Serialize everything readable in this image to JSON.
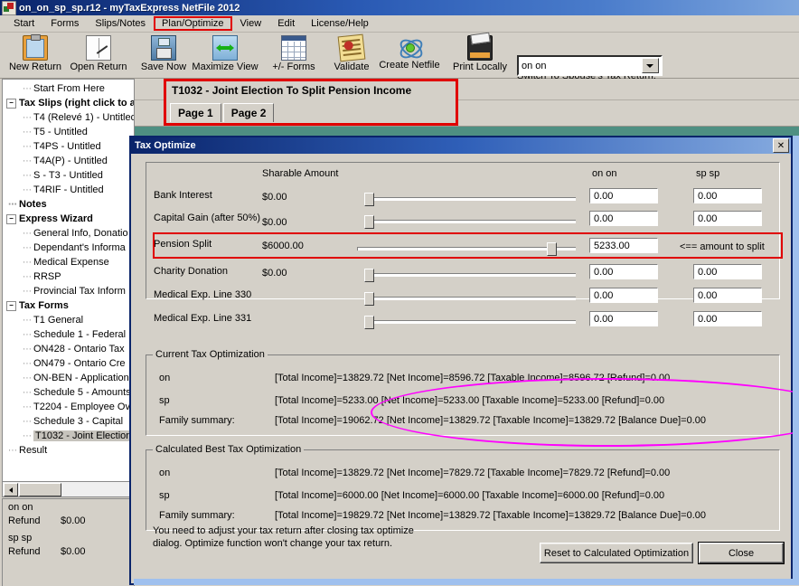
{
  "window": {
    "title": "on_on_sp_sp.r12 - myTaxExpress NetFile 2012",
    "app_icon": "app-icon"
  },
  "menu": {
    "items": [
      {
        "label": "Start",
        "highlighted": false
      },
      {
        "label": "Forms",
        "highlighted": false
      },
      {
        "label": "Slips/Notes",
        "highlighted": false
      },
      {
        "label": "Plan/Optimize",
        "highlighted": true
      },
      {
        "label": "View",
        "highlighted": false
      },
      {
        "label": "Edit",
        "highlighted": false
      },
      {
        "label": "License/Help",
        "highlighted": false
      }
    ]
  },
  "toolbar": {
    "buttons": [
      {
        "label": "New Return",
        "icon": "clipboard-icon"
      },
      {
        "label": "Open Return",
        "icon": "open-book-icon"
      },
      {
        "label": "Save Now",
        "icon": "floppy-disk-icon"
      },
      {
        "label": "Maximize View",
        "icon": "maximize-arrows-icon"
      },
      {
        "label": "+/- Forms",
        "icon": "grid-forms-icon"
      },
      {
        "label": "Validate",
        "icon": "validate-seal-icon"
      },
      {
        "label": "Create Netfile",
        "icon": "atom-icon"
      },
      {
        "label": "Print Locally",
        "icon": "printer-icon"
      }
    ],
    "switch_label": "Switch To Spouse's Tax Return:",
    "switch_value": "on on"
  },
  "sidebar": {
    "items": [
      {
        "label": "Start From Here",
        "level": 2,
        "bold": false,
        "expander": "",
        "selected": false
      },
      {
        "label": "Tax Slips (right click to add t",
        "level": 1,
        "bold": true,
        "expander": "-",
        "selected": false
      },
      {
        "label": "T4 (Relevé 1) - Untitled",
        "level": 2,
        "bold": false,
        "expander": "",
        "selected": false
      },
      {
        "label": "T5 - Untitled",
        "level": 2,
        "bold": false,
        "expander": "",
        "selected": false
      },
      {
        "label": "T4PS - Untitled",
        "level": 2,
        "bold": false,
        "expander": "",
        "selected": false
      },
      {
        "label": "T4A(P) - Untitled",
        "level": 2,
        "bold": false,
        "expander": "",
        "selected": false
      },
      {
        "label": "S - T3 - Untitled",
        "level": 2,
        "bold": false,
        "expander": "",
        "selected": false
      },
      {
        "label": "T4RIF - Untitled",
        "level": 2,
        "bold": false,
        "expander": "",
        "selected": false
      },
      {
        "label": "Notes",
        "level": 1,
        "bold": true,
        "expander": "",
        "selected": false
      },
      {
        "label": "Express Wizard",
        "level": 1,
        "bold": true,
        "expander": "-",
        "selected": false
      },
      {
        "label": "General Info, Donatio",
        "level": 2,
        "bold": false,
        "expander": "",
        "selected": false
      },
      {
        "label": "Dependant's Informa",
        "level": 2,
        "bold": false,
        "expander": "",
        "selected": false
      },
      {
        "label": "Medical Expense",
        "level": 2,
        "bold": false,
        "expander": "",
        "selected": false
      },
      {
        "label": "RRSP",
        "level": 2,
        "bold": false,
        "expander": "",
        "selected": false
      },
      {
        "label": "Provincial Tax Inform",
        "level": 2,
        "bold": false,
        "expander": "",
        "selected": false
      },
      {
        "label": "Tax Forms",
        "level": 1,
        "bold": true,
        "expander": "-",
        "selected": false
      },
      {
        "label": "T1 General",
        "level": 2,
        "bold": false,
        "expander": "",
        "selected": false
      },
      {
        "label": "Schedule 1 - Federal",
        "level": 2,
        "bold": false,
        "expander": "",
        "selected": false
      },
      {
        "label": "ON428 - Ontario Tax",
        "level": 2,
        "bold": false,
        "expander": "",
        "selected": false
      },
      {
        "label": "ON479 - Ontario Cre",
        "level": 2,
        "bold": false,
        "expander": "",
        "selected": false
      },
      {
        "label": "ON-BEN - Application",
        "level": 2,
        "bold": false,
        "expander": "",
        "selected": false
      },
      {
        "label": "Schedule 5 - Amounts",
        "level": 2,
        "bold": false,
        "expander": "",
        "selected": false
      },
      {
        "label": "T2204 - Employee Ov",
        "level": 2,
        "bold": false,
        "expander": "",
        "selected": false
      },
      {
        "label": "Schedule 3 - Capital",
        "level": 2,
        "bold": false,
        "expander": "",
        "selected": false
      },
      {
        "label": "T1032 - Joint Election",
        "level": 2,
        "bold": false,
        "expander": "",
        "selected": true
      },
      {
        "label": "Result",
        "level": 1,
        "bold": false,
        "expander": "",
        "selected": false
      }
    ]
  },
  "refund_panel": {
    "rows": [
      {
        "name": "on on",
        "key": "",
        "value": ""
      },
      {
        "name": "",
        "key": "Refund",
        "value": "$0.00"
      },
      {
        "name": "sp sp",
        "key": "",
        "value": ""
      },
      {
        "name": "",
        "key": "Refund",
        "value": "$0.00"
      }
    ]
  },
  "form": {
    "title": "T1032 - Joint Election To Split Pension Income",
    "tabs": [
      {
        "label": "Page 1",
        "active": true
      },
      {
        "label": "Page 2",
        "active": false
      }
    ]
  },
  "dialog": {
    "title": "Tax Optimize",
    "close_icon": "close-icon",
    "close_glyph": "✕",
    "headers": {
      "sharable_amount": "Sharable Amount",
      "col_on": "on on",
      "col_sp": "sp sp"
    },
    "rows": [
      {
        "label": "Bank Interest",
        "amount": "$0.00",
        "slider_pct": 0,
        "on_value": "0.00",
        "sp_value": "0.00",
        "note": "",
        "highlighted": false
      },
      {
        "label": "Capital Gain (after 50%)",
        "amount": "$0.00",
        "slider_pct": 0,
        "on_value": "0.00",
        "sp_value": "0.00",
        "note": "",
        "highlighted": false
      },
      {
        "label": "Pension Split",
        "amount": "$6000.00",
        "slider_pct": 87,
        "on_value": "5233.00",
        "sp_value": "",
        "note": "<== amount to split",
        "highlighted": true
      },
      {
        "label": "Charity Donation",
        "amount": "$0.00",
        "slider_pct": 0,
        "on_value": "0.00",
        "sp_value": "0.00",
        "note": "",
        "highlighted": false
      },
      {
        "label": "Medical Exp. Line 330",
        "amount": "",
        "slider_pct": 0,
        "on_value": "0.00",
        "sp_value": "0.00",
        "note": "",
        "highlighted": false
      },
      {
        "label": "Medical Exp. Line 331",
        "amount": "",
        "slider_pct": 0,
        "on_value": "0.00",
        "sp_value": "0.00",
        "note": "",
        "highlighted": false
      }
    ],
    "current": {
      "title": "Current Tax Optimization",
      "rows": [
        {
          "key": "on",
          "value": "[Total Income]=13829.72 [Net Income]=8596.72 [Taxable Income]=8596.72 [Refund]=0.00"
        },
        {
          "key": "sp",
          "value": "[Total Income]=5233.00 [Net Income]=5233.00 [Taxable Income]=5233.00 [Refund]=0.00"
        },
        {
          "key": "Family summary:",
          "value": "[Total Income]=19062.72 [Net Income]=13829.72 [Taxable Income]=13829.72 [Balance Due]=0.00"
        }
      ]
    },
    "best": {
      "title": "Calculated Best Tax Optimization",
      "rows": [
        {
          "key": "on",
          "value": "[Total Income]=13829.72 [Net Income]=7829.72 [Taxable Income]=7829.72 [Refund]=0.00"
        },
        {
          "key": "sp",
          "value": "[Total Income]=6000.00 [Net Income]=6000.00 [Taxable Income]=6000.00 [Refund]=0.00"
        },
        {
          "key": "Family summary:",
          "value": "[Total Income]=19829.72 [Net Income]=13829.72 [Taxable Income]=13829.72 [Balance Due]=0.00"
        }
      ]
    },
    "footnote_line1": "You need to adjust your tax return after closing tax optimize",
    "footnote_line2": "dialog. Optimize function won't change your tax return.",
    "reset_button": "Reset to Calculated Optimization",
    "close_button": "Close"
  },
  "annotations": {
    "highlight_color": "#e00000",
    "ellipse_color": "#ff00ff"
  }
}
